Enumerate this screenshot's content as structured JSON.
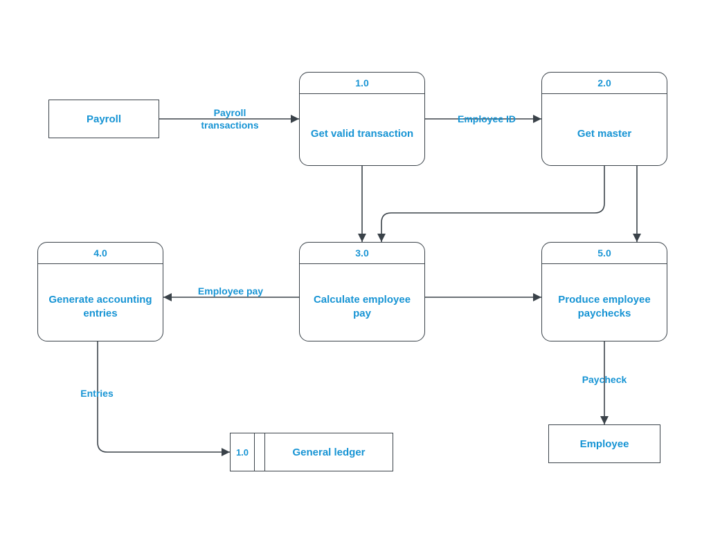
{
  "colors": {
    "stroke": "#3a4249",
    "text": "#1794d4",
    "bg": "#ffffff"
  },
  "entities": {
    "payroll": {
      "label": "Payroll"
    },
    "employee": {
      "label": "Employee"
    }
  },
  "processes": {
    "p1": {
      "id": "1.0",
      "title": "Get valid transaction"
    },
    "p2": {
      "id": "2.0",
      "title": "Get master"
    },
    "p3": {
      "id": "3.0",
      "title": "Calculate employee pay"
    },
    "p4": {
      "id": "4.0",
      "title": "Generate accounting entries"
    },
    "p5": {
      "id": "5.0",
      "title": "Produce employee paychecks"
    }
  },
  "datastore": {
    "ledger": {
      "id": "1.0",
      "label": "General ledger"
    }
  },
  "flows": {
    "f_payroll_p1": "Payroll transactions",
    "f_p1_p2": "Employee ID",
    "f_p3_p4": "Employee pay",
    "f_p4_ledger": "Entries",
    "f_p5_employee": "Paycheck"
  }
}
